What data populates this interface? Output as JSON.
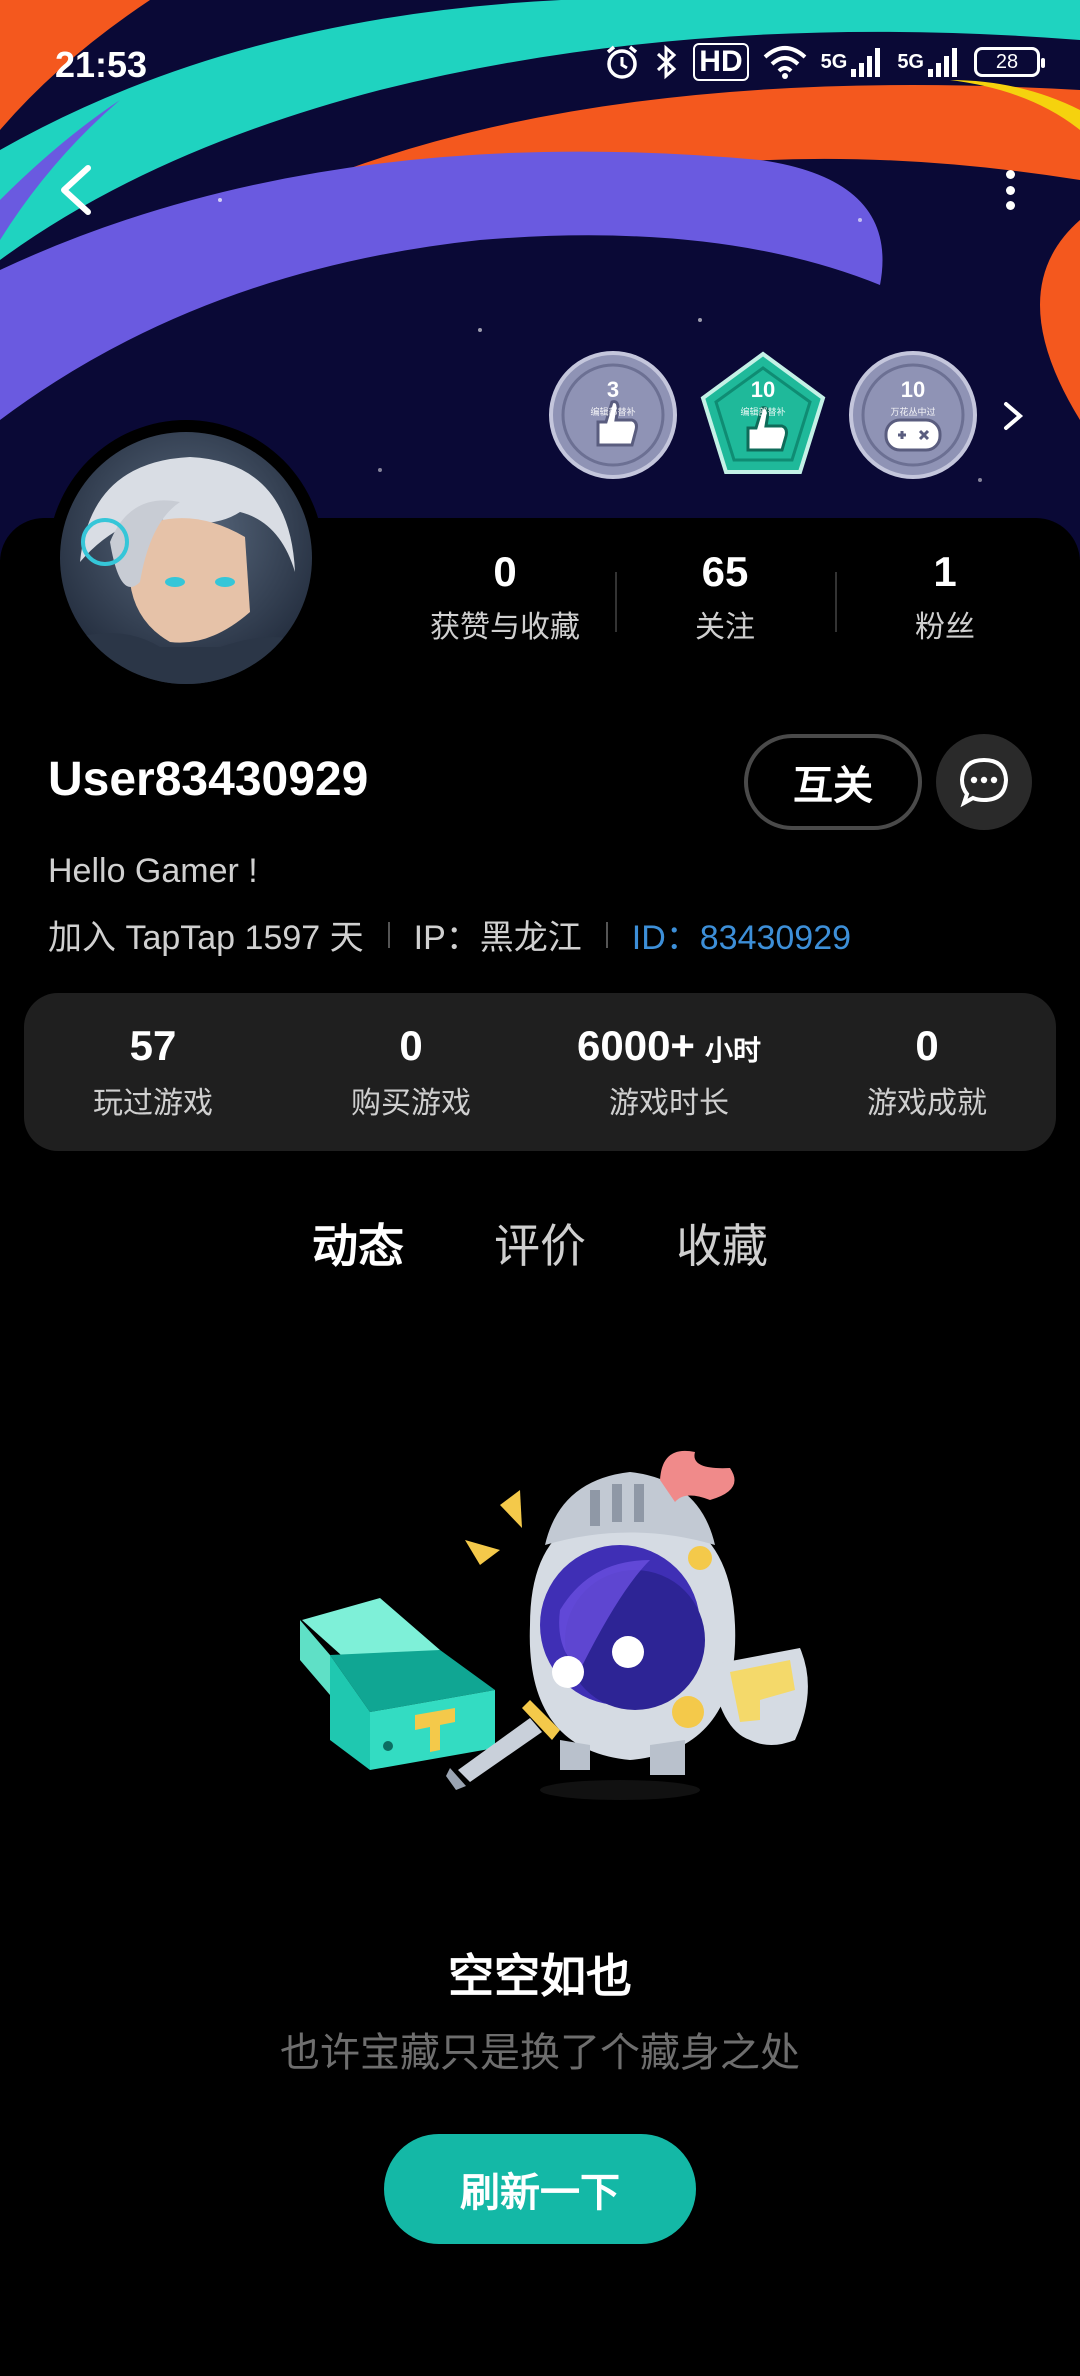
{
  "status_bar": {
    "time": "21:53",
    "hd_label": "HD",
    "network_1": "5G",
    "network_2": "5G",
    "battery": "28"
  },
  "header": {
    "back_icon": "chevron-left-icon",
    "more_icon": "more-vertical-icon",
    "badges": [
      {
        "number": "3",
        "caption": "编辑部替补",
        "icon": "thumbs-up-icon",
        "color": "#8f93b5"
      },
      {
        "number": "10",
        "caption": "编辑部替补",
        "icon": "thumbs-up-icon",
        "color": "#1fb99a"
      },
      {
        "number": "10",
        "caption": "万花丛中过",
        "icon": "gamepad-icon",
        "color": "#8f93b5"
      }
    ]
  },
  "profile": {
    "counts": [
      {
        "value": "0",
        "label": "获赞与收藏"
      },
      {
        "value": "65",
        "label": "关注"
      },
      {
        "value": "1",
        "label": "粉丝"
      }
    ],
    "username": "User83430929",
    "mutual_label": "互关",
    "bio": "Hello Gamer !",
    "joined": "加入 TapTap 1597 天",
    "ip": "IP：黑龙江",
    "id": "ID：83430929"
  },
  "stats": [
    {
      "value": "57",
      "unit": "",
      "label": "玩过游戏"
    },
    {
      "value": "0",
      "unit": "",
      "label": "购买游戏"
    },
    {
      "value": "6000+",
      "unit": "小时",
      "label": "游戏时长"
    },
    {
      "value": "0",
      "unit": "",
      "label": "游戏成就"
    }
  ],
  "tabs": [
    {
      "label": "动态",
      "active": true
    },
    {
      "label": "评价",
      "active": false
    },
    {
      "label": "收藏",
      "active": false
    }
  ],
  "empty_state": {
    "title": "空空如也",
    "subtitle": "也许宝藏只是换了个藏身之处",
    "refresh_label": "刷新一下"
  },
  "colors": {
    "accent": "#14b8a6",
    "id_link": "#3d8fd8",
    "card_bg": "#1f1f1f"
  }
}
